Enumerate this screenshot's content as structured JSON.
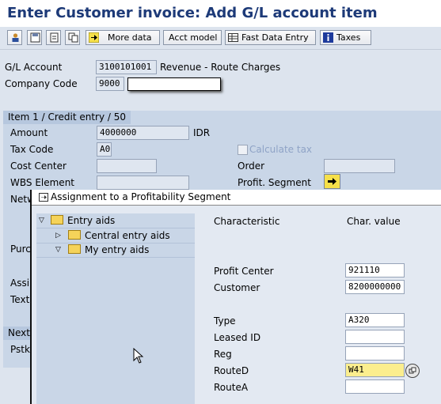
{
  "window": {
    "title": "Enter Customer invoice: Add G/L account item"
  },
  "toolbar": {
    "more_data": "More data",
    "acct_model": "Acct model",
    "fast_data_entry": "Fast Data Entry",
    "taxes": "Taxes"
  },
  "header_fields": {
    "gl_account_label": "G/L Account",
    "gl_account_value": "3100101001",
    "gl_account_text": "Revenue - Route Charges",
    "company_code_label": "Company Code",
    "company_code_value": "9000"
  },
  "item": {
    "title": "Item 1 / Credit entry / 50",
    "amount_label": "Amount",
    "amount_value": "4000000",
    "currency": "IDR",
    "tax_code_label": "Tax Code",
    "tax_code_value": "A0",
    "calculate_tax_label": "Calculate tax",
    "cost_center_label": "Cost Center",
    "order_label": "Order",
    "wbs_label": "WBS Element",
    "profit_segment_label": "Profit. Segment",
    "netw_partial": "Netw",
    "purc_partial": "Purc",
    "assi_partial": "Assi",
    "text_label": "Text",
    "next_partial": "Next",
    "pstk_partial": "Pstk"
  },
  "dialog": {
    "title": "Assignment to a Profitability Segment",
    "tree": {
      "root": "Entry aids",
      "children": [
        "Central entry aids",
        "My entry aids"
      ]
    },
    "col_characteristic": "Characteristic",
    "col_value": "Char. value",
    "rows": [
      {
        "label": "Profit Center",
        "value": "921110"
      },
      {
        "label": "Customer",
        "value": "8200000000"
      },
      {
        "label": "Type",
        "value": "A320"
      },
      {
        "label": "Leased ID",
        "value": ""
      },
      {
        "label": "Reg",
        "value": ""
      },
      {
        "label": "RouteD",
        "value": "W41"
      },
      {
        "label": "RouteA",
        "value": ""
      }
    ]
  }
}
